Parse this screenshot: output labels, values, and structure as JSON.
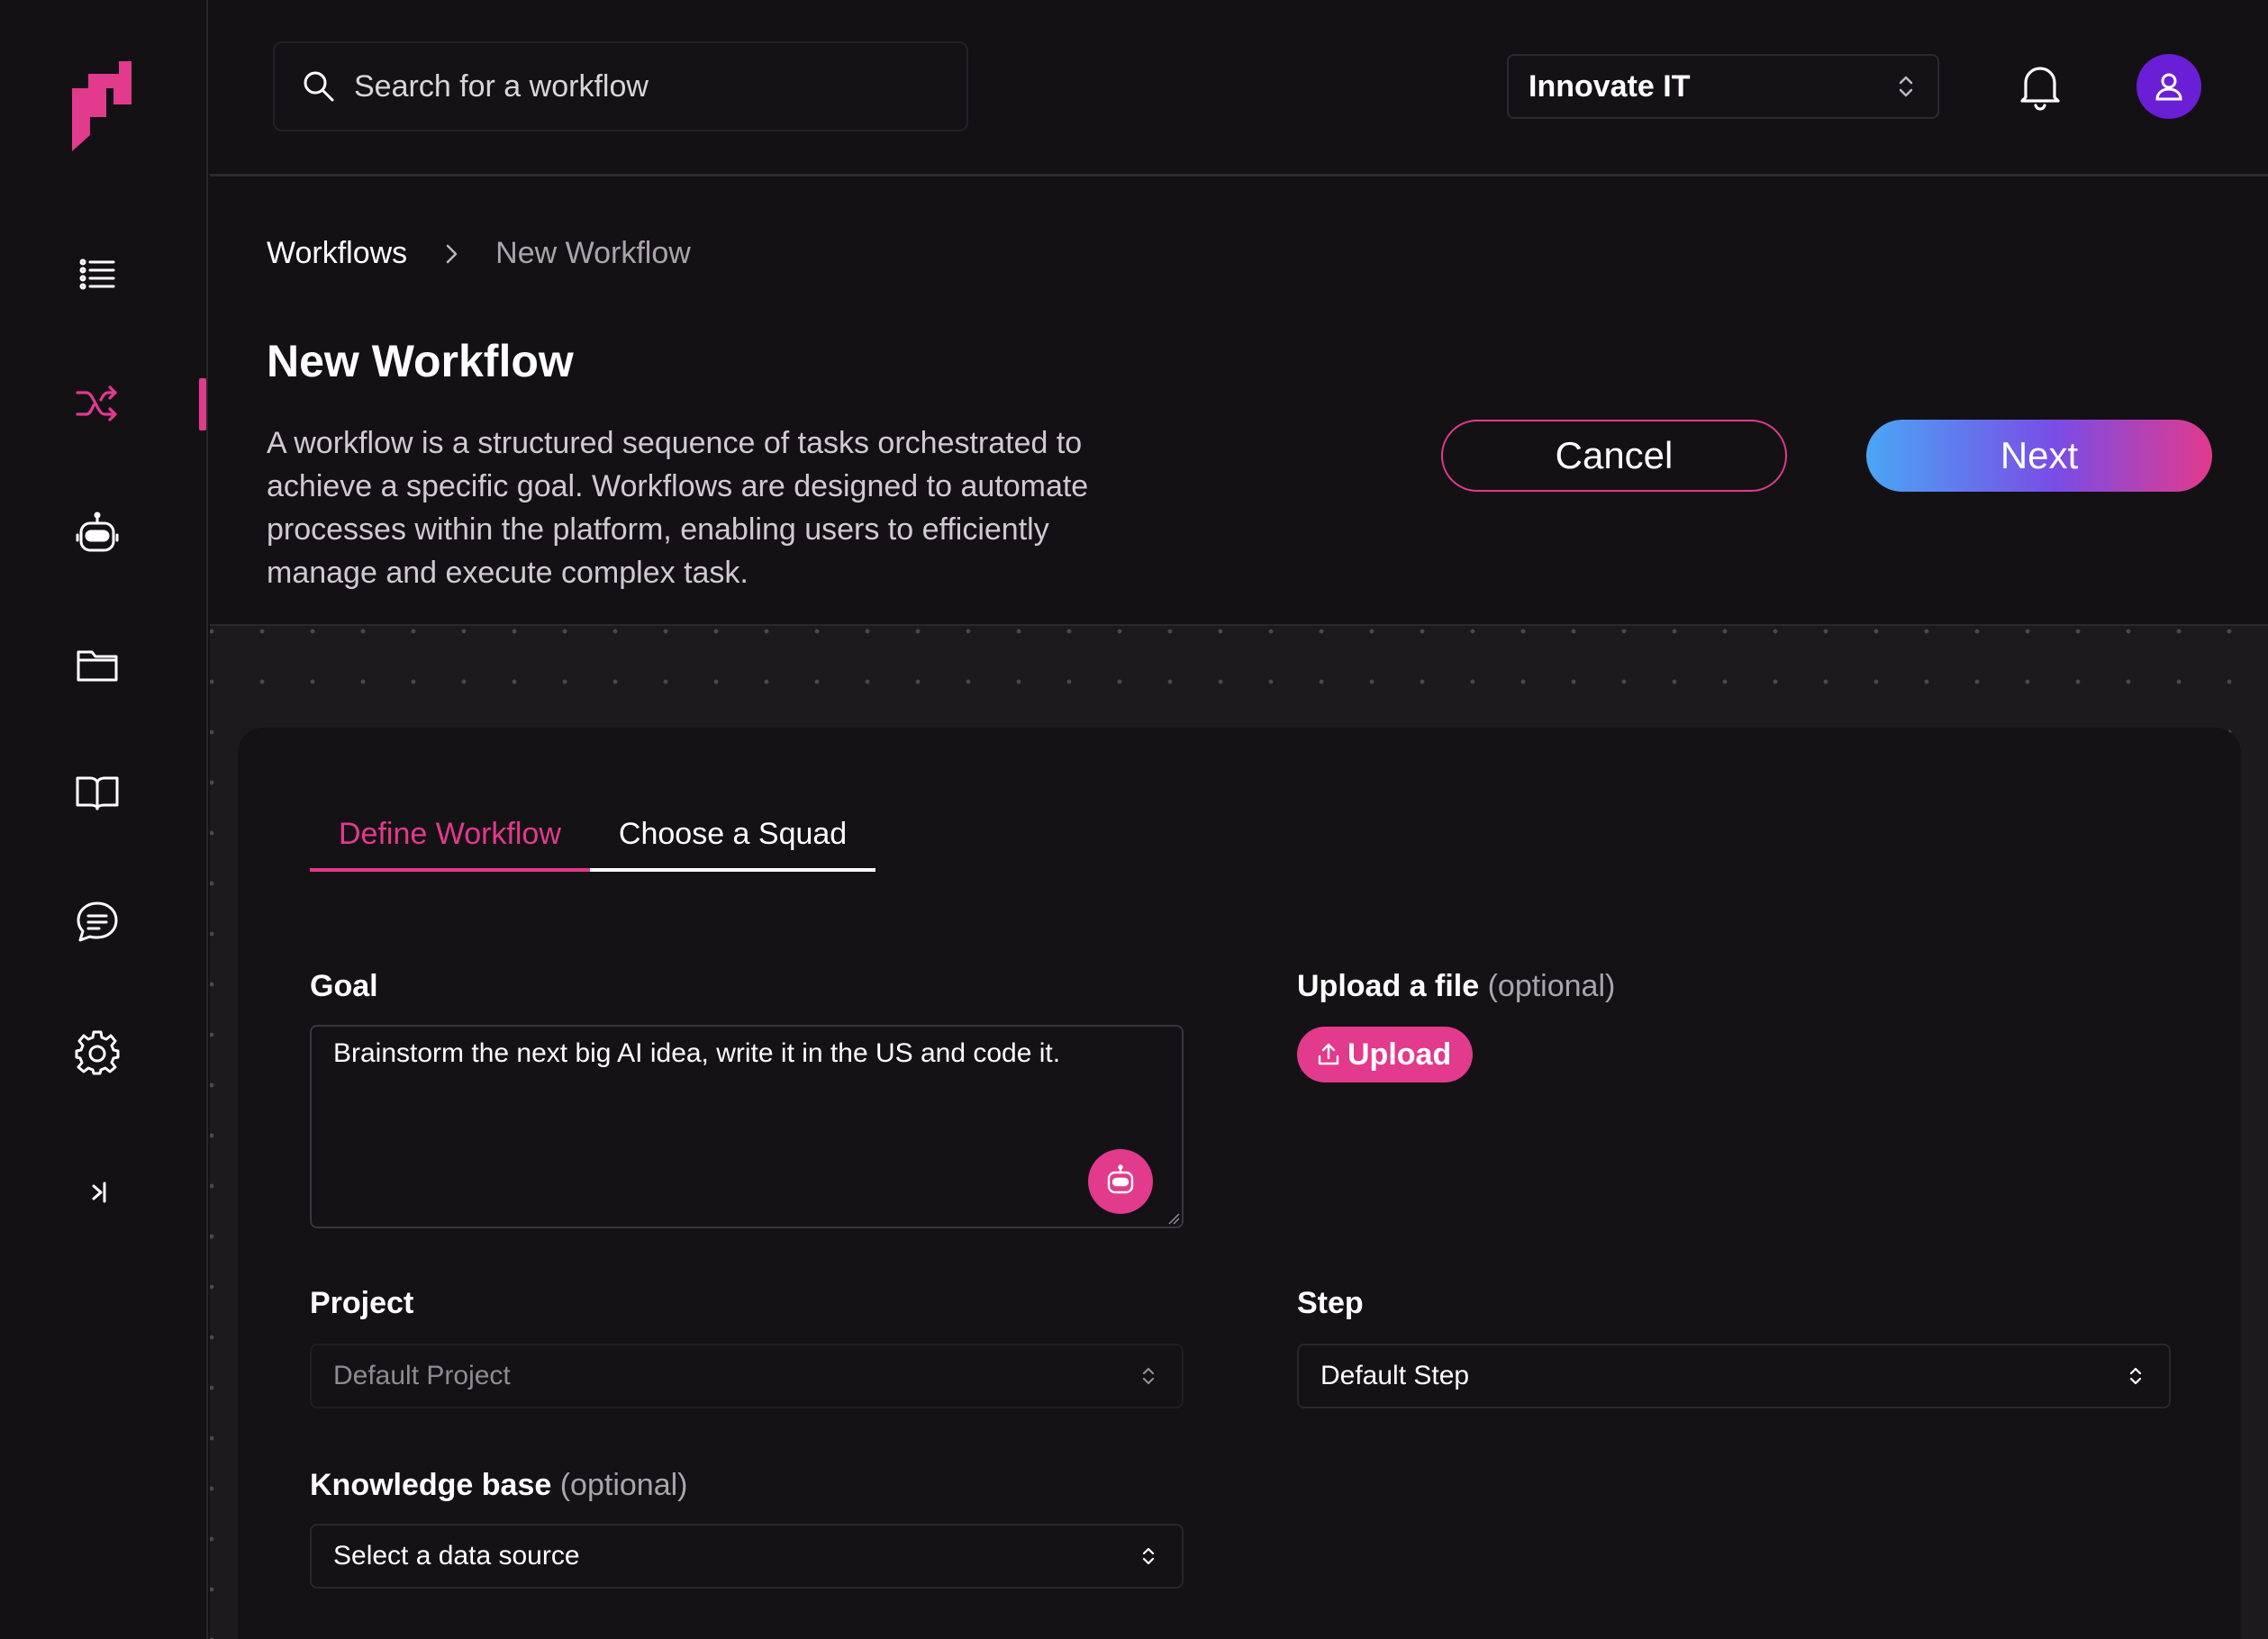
{
  "header": {
    "search_placeholder": "Search for a workflow",
    "org_selector_value": "Innovate IT"
  },
  "sidebar": {
    "items": [
      {
        "name": "list",
        "icon": "list-icon"
      },
      {
        "name": "workflows",
        "icon": "shuffle-icon",
        "active": true
      },
      {
        "name": "agents",
        "icon": "robot-icon"
      },
      {
        "name": "files",
        "icon": "folder-icon"
      },
      {
        "name": "docs",
        "icon": "book-icon"
      },
      {
        "name": "chat",
        "icon": "chat-icon"
      },
      {
        "name": "settings",
        "icon": "gear-icon"
      },
      {
        "name": "expand",
        "icon": "expand-sidebar-icon"
      }
    ]
  },
  "breadcrumb": {
    "parent": "Workflows",
    "current": "New Workflow"
  },
  "page": {
    "title": "New Workflow",
    "description": "A workflow is a structured sequence of tasks orchestrated to achieve a specific goal. Workflows are designed to automate processes within the platform, enabling users to efficiently manage and execute complex task.",
    "cancel_label": "Cancel",
    "next_label": "Next"
  },
  "tabs": {
    "define": "Define Workflow",
    "squad": "Choose a Squad"
  },
  "form": {
    "goal_label": "Goal",
    "goal_value": "Brainstorm the next big AI idea, write it in the US and code it.",
    "upload_label": "Upload a file",
    "upload_optional": "(optional)",
    "upload_button": "Upload",
    "project_label": "Project",
    "project_value": "Default Project",
    "step_label": "Step",
    "step_value": "Default Step",
    "kb_label": "Knowledge base",
    "kb_optional": "(optional)",
    "kb_value": "Select a data source"
  },
  "colors": {
    "accent": "#e23a8c",
    "avatar": "#6a1fd6",
    "background": "#141115",
    "next_gradient_start": "#4aa6f4",
    "next_gradient_end": "#e23a8c"
  }
}
